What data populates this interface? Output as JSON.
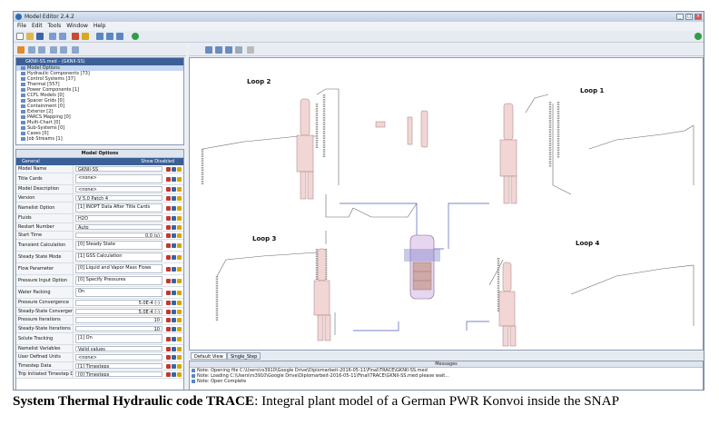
{
  "window": {
    "title": "Model Editor 2.4.2"
  },
  "menu": [
    "File",
    "Edit",
    "Tools",
    "Window",
    "Help"
  ],
  "tree": {
    "root": "GKNII-SS.med - (GKNII-SS)",
    "items": [
      "Model Options",
      "Hydraulic Components [73]",
      "Control Systems [37]",
      "Thermal [557]",
      "Power Components [1]",
      "CCFL Models [0]",
      "Spacer Grids [0]",
      "Containment [0]",
      "Exterior [2]",
      "PARCS Mapping [0]",
      "Multi-Chart [0]",
      "Sub-Systems [0]",
      "Cases [0]",
      "Job Streams [1]"
    ]
  },
  "props": {
    "title": "Model Options",
    "group": "General",
    "show_disabled": "Show Disabled",
    "rows": [
      {
        "label": "Model Name",
        "value": "GKNII-SS"
      },
      {
        "label": "Title Cards",
        "value": "<none>"
      },
      {
        "label": "Model Description",
        "value": "<none>"
      },
      {
        "label": "Version",
        "value": "V 5.0 Patch 4"
      },
      {
        "label": "Namelist Option",
        "value": "[1] INOPT Data After Title Cards"
      },
      {
        "label": "Fluids",
        "value": "H2O"
      },
      {
        "label": "Restart Number",
        "value": "Auto"
      },
      {
        "label": "Start Time",
        "value": "0.0 (s)"
      },
      {
        "label": "Transient Calculation",
        "value": "[0] Steady State"
      },
      {
        "label": "Steady State Mode",
        "value": "[1] GSS Calculation"
      },
      {
        "label": "Flow Parameter",
        "value": "[0] Liquid and Vapor Mass Flows"
      },
      {
        "label": "Pressure Input Option",
        "value": "[0] Specify Pressures"
      },
      {
        "label": "Water Packing",
        "value": "On"
      },
      {
        "label": "Pressure Convergence",
        "value": "5.0E-4 (-)"
      },
      {
        "label": "Steady-State Convergence",
        "value": "5.0E-4 (-)"
      },
      {
        "label": "Pressure Iterations",
        "value": "10"
      },
      {
        "label": "Steady-State Iterations",
        "value": "10"
      },
      {
        "label": "Solute Tracking",
        "value": "[1] On"
      },
      {
        "label": "Namelist Variables",
        "value": "Valid values"
      },
      {
        "label": "User Defined Units",
        "value": "<none>"
      },
      {
        "label": "Timestep Data",
        "value": "[1] Timesteps"
      },
      {
        "label": "Trip Initiated Timestep Data",
        "value": "[0] Timesteps"
      }
    ]
  },
  "canvas": {
    "loops": [
      "Loop 2",
      "Loop 1",
      "Loop 3",
      "Loop 4"
    ]
  },
  "tabs": [
    "Default View",
    "Single_Step"
  ],
  "messages": {
    "title": "Messages",
    "lines": [
      "Note: Opening file C:\\Users\\rs3910\\Google Drive\\Diplomarbeit-2016-05-11\\Final\\TRACE\\GKNII-SS.med",
      "Note: Loading C:\\Users\\rs3910\\Google Drive\\Diplomarbeit-2016-05-11\\Final\\TRACE\\GKNII-SS.med please wait...",
      "Note: Open Complete"
    ]
  },
  "caption": {
    "bold": "System Thermal Hydraulic code TRACE",
    "text": ":  Integral plant model of a German PWR Konvoi inside the SNAP"
  }
}
